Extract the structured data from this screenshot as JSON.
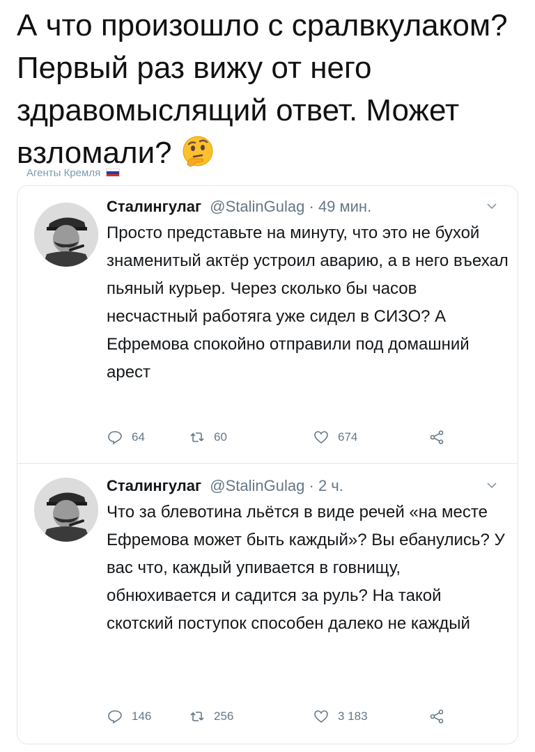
{
  "headline": {
    "text": "А что произошло с сралвкулаком? Первый раз вижу от него здравомыслящий ответ. Может взломали?",
    "emoji": "thinking-face-emoji"
  },
  "channel": {
    "label": "Агенты Кремля",
    "flag_colors": [
      "#ffffff",
      "#1c3fa8",
      "#d52b1e"
    ]
  },
  "tweets": [
    {
      "name": "Сталингулаг",
      "handle": "@StalinGulag",
      "time": "· 49 мин.",
      "text": "Просто представьте на минуту, что это не бухой знаменитый актёр устроил аварию, а в него въехал пьяный курьер. Через сколько бы часов несчастный работяга уже сидел в СИЗО? А Ефремова спокойно отправили под домашний арест",
      "replies": "64",
      "retweets": "60",
      "likes": "674"
    },
    {
      "name": "Сталингулаг",
      "handle": "@StalinGulag",
      "time": "· 2 ч.",
      "text": "Что за блевотина льётся в виде речей «на месте Ефремова может быть каждый»? Вы ебанулись? У вас что, каждый упивается в говнищу, обнюхивается и садится за руль? На такой скотский поступок способен далеко не каждый",
      "replies": "146",
      "retweets": "256",
      "likes": "3 183"
    }
  ],
  "icons": {
    "reply": "reply-icon",
    "retweet": "retweet-icon",
    "like": "heart-icon",
    "share": "share-icon",
    "caret": "chevron-down-icon"
  },
  "colors": {
    "text": "#14171a",
    "secondary": "#657786",
    "border": "#e1e8ed",
    "channel": "#7a9bb0"
  }
}
